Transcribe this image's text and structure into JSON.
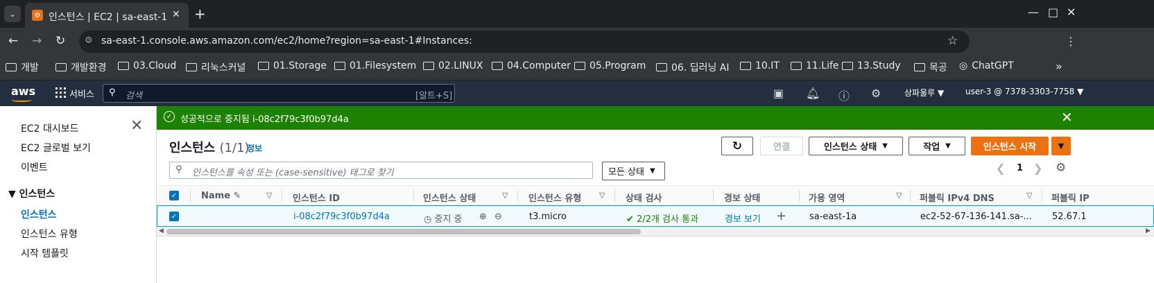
{
  "browser": {
    "tab_title": "인스턴스 | EC2 | sa-east-1",
    "url": "sa-east-1.console.aws.amazon.com/ec2/home?region=sa-east-1#Instances:",
    "bookmarks": [
      "개발",
      "개발환경",
      "03.Cloud",
      "리눅스커널",
      "01.Storage",
      "01.Filesystem",
      "02.LINUX",
      "04.Computer",
      "05.Program",
      "06. 딥러닝 AI",
      "10.IT",
      "11.Life",
      "13.Study",
      "목공",
      "ChatGPT"
    ]
  },
  "aws_header": {
    "logo": "aws",
    "services_label": "서비스",
    "search_placeholder": "검색",
    "search_shortcut": "[알트+S]",
    "region": "상파울루 ▼",
    "account": "user-3 @ 7378-3303-7758 ▼"
  },
  "sidenav": {
    "items": [
      "EC2 대시보드",
      "EC2 글로벌 보기",
      "이벤트"
    ],
    "section": "인스턴스",
    "active": "인스턴스",
    "sub_items": [
      "인스턴스 유형",
      "시작 템플릿"
    ]
  },
  "flash": {
    "message": "성공적으로 중지됨 i-08c2f79c3f0b97d4a"
  },
  "panel": {
    "title": "인스턴스",
    "count": "(1/1)",
    "info": "정보",
    "buttons": {
      "connect": "연결",
      "instance_state": "인스턴스 상태",
      "actions": "작업",
      "launch": "인스턴스 시작"
    },
    "filter_placeholder": "인스턴스를 속성 또는 (case-sensitive) 태그로 찾기",
    "state_filter": "모든 상태",
    "page": "1"
  },
  "table": {
    "columns": [
      "Name",
      "인스턴스 ID",
      "인스턴스 상태",
      "인스턴스 유형",
      "상태 검사",
      "경보 상태",
      "가용 영역",
      "퍼블릭 IPv4 DNS",
      "퍼블릭 IP"
    ],
    "row": {
      "name": "",
      "instance_id": "i-08c2f79c3f0b97d4a",
      "state": "중지 중",
      "type": "t3.micro",
      "status_check": "2/2개 검사 통과",
      "alarm": "경보 보기",
      "az": "sa-east-1a",
      "public_dns": "ec2-52-67-136-141.sa-...",
      "public_ip": "52.67.1"
    }
  },
  "colors": {
    "aws_header": "#232f3e",
    "success": "#1d8102",
    "primary_button": "#ec7211",
    "link": "#0073bb"
  }
}
